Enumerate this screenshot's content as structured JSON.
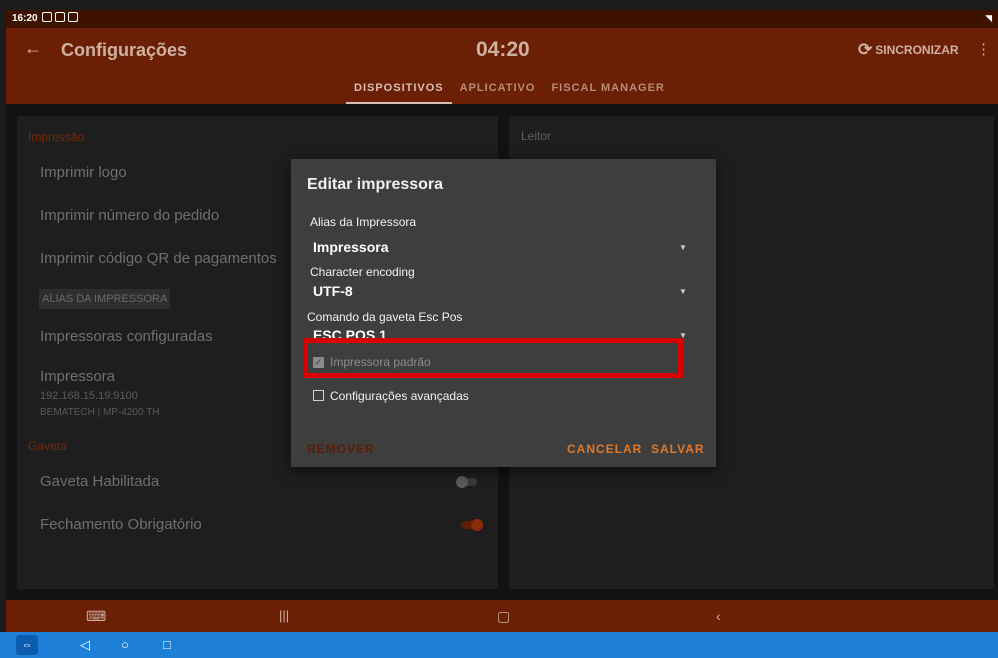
{
  "status_bar": {
    "time": "16:20",
    "icons": [
      "eye-icon",
      "cast-icon",
      "image-icon"
    ],
    "right": "wifi + signal"
  },
  "app_bar": {
    "title": "Configurações",
    "clock": "04:20",
    "sync_label": "SINCRONIZAR",
    "tabs": [
      {
        "label": "DISPOSITIVOS",
        "active": true
      },
      {
        "label": "APLICATIVO",
        "active": false
      },
      {
        "label": "FISCAL MANAGER",
        "active": false
      }
    ]
  },
  "left_card": {
    "printing_section": "Impressão",
    "rows": [
      "Imprimir logo",
      "Imprimir número do pedido",
      "Imprimir código QR de pagamentos"
    ],
    "alias_chip": "ALIAS DA IMPRESSORA",
    "configured_label": "Impressoras configuradas",
    "printer": {
      "name": "Impressora",
      "ip": "192.168.15.19:9100",
      "model": "BEMATECH | MP-4200 TH"
    },
    "drawer_section": "Gaveta",
    "drawer_rows": [
      {
        "label": "Gaveta Habilitada",
        "enabled": false
      },
      {
        "label": "Fechamento Obrigatório",
        "enabled": true
      }
    ]
  },
  "right_card": {
    "section": "Leitor"
  },
  "dialog": {
    "title": "Editar impressora",
    "fields": [
      {
        "label": "Alias da Impressora",
        "value": "Impressora"
      },
      {
        "label": "Character encoding",
        "value": "UTF-8"
      },
      {
        "label": "Comando da gaveta Esc Pos",
        "value": "ESC POS 1"
      }
    ],
    "default_printer": {
      "label": "Impressora padrão",
      "checked": true,
      "disabled": true
    },
    "advanced": {
      "label": "Configurações avançadas",
      "checked": false
    },
    "remove_label": "REMOVER",
    "cancel_label": "CANCELAR",
    "save_label": "SALVAR"
  },
  "colors": {
    "app_bar": "#6b1f04",
    "accent": "#e0782a",
    "highlight": "#d80000",
    "taskbar": "#1e7fd8"
  }
}
